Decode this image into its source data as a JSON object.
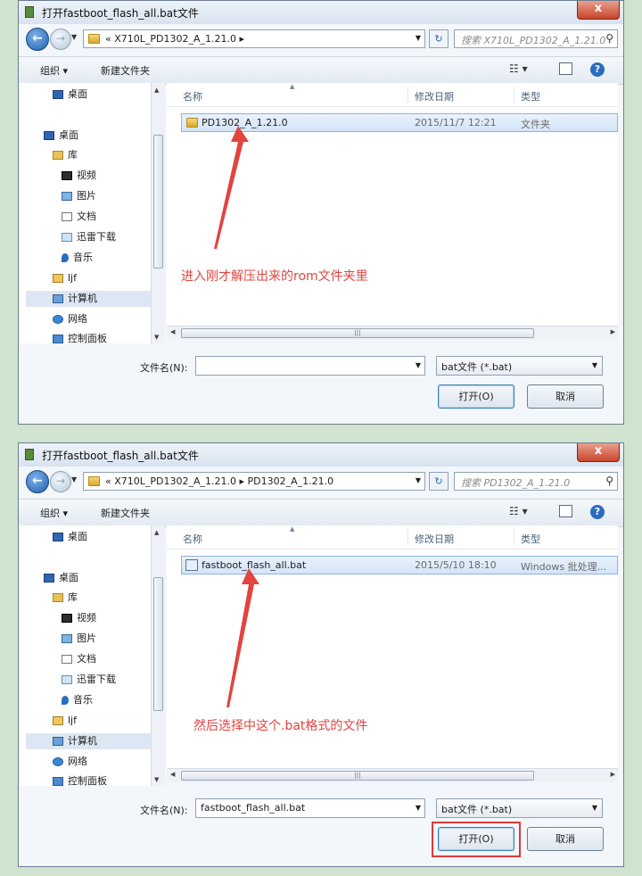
{
  "colors": {
    "annotation": "#e2443f",
    "highlight_box": "#e0373a",
    "selection": "#d3e4f8"
  },
  "dialogs": [
    {
      "title": "打开fastboot_flash_all.bat文件",
      "close": "x",
      "address": "«                X710L_PD1302_A_1.21.0  ▸",
      "search_placeholder": "搜索 X710L_PD1302_A_1.21.0",
      "organize": "组织 ▾",
      "new_folder": "新建文件夹",
      "nav": [
        "桌面",
        "桌面",
        "库",
        "视频",
        "图片",
        "文档",
        "迅雷下载",
        "音乐",
        "ljf",
        "计算机",
        "网络",
        "控制面板"
      ],
      "columns": {
        "name": "名称",
        "date": "修改日期",
        "type": "类型"
      },
      "file": {
        "name": "PD1302_A_1.21.0",
        "date": "2015/11/7 12:21",
        "type": "文件夹"
      },
      "annotation": "进入刚才解压出来的rom文件夹里",
      "filename_label": "文件名(N):",
      "filename_value": "",
      "filetype": "bat文件 (*.bat)",
      "open": "打开(O)",
      "cancel": "取消"
    },
    {
      "title": "打开fastboot_flash_all.bat文件",
      "close": "x",
      "address": "«  X710L_PD1302_A_1.21.0  ▸  PD1302_A_1.21.0",
      "search_placeholder": "搜索 PD1302_A_1.21.0",
      "organize": "组织 ▾",
      "new_folder": "新建文件夹",
      "nav": [
        "桌面",
        "桌面",
        "库",
        "视频",
        "图片",
        "文档",
        "迅雷下载",
        "音乐",
        "ljf",
        "计算机",
        "网络",
        "控制面板"
      ],
      "columns": {
        "name": "名称",
        "date": "修改日期",
        "type": "类型"
      },
      "file": {
        "name": "fastboot_flash_all.bat",
        "date": "2015/5/10 18:10",
        "type": "Windows 批处理..."
      },
      "annotation": "然后选择中这个.bat格式的文件",
      "filename_label": "文件名(N):",
      "filename_value": "fastboot_flash_all.bat",
      "filetype": "bat文件 (*.bat)",
      "open": "打开(O)",
      "cancel": "取消"
    }
  ]
}
